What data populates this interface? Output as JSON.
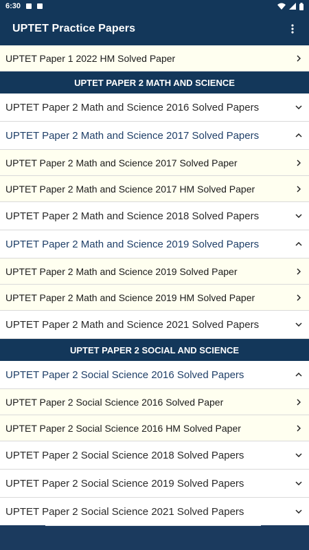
{
  "status_bar": {
    "time": "6:30"
  },
  "app_bar": {
    "title": "UPTET Practice Papers"
  },
  "colors": {
    "primary": "#13375a",
    "sub_item_bg": "#fffff0",
    "expanded_text": "#1f3f68"
  },
  "rows": [
    {
      "kind": "sub",
      "label": "UPTET Paper 1 2022 HM Solved Paper",
      "icon": "chevron-right-icon"
    },
    {
      "kind": "header",
      "label": "UPTET PAPER 2 MATH AND SCIENCE"
    },
    {
      "kind": "group",
      "label": "UPTET Paper 2 Math and Science 2016 Solved Papers",
      "icon": "chevron-down-icon",
      "expanded": false
    },
    {
      "kind": "group",
      "label": "UPTET Paper 2 Math and Science 2017 Solved Papers",
      "icon": "chevron-up-icon",
      "expanded": true
    },
    {
      "kind": "sub",
      "label": "UPTET Paper 2 Math and Science 2017 Solved Paper",
      "icon": "chevron-right-icon"
    },
    {
      "kind": "sub",
      "label": "UPTET Paper 2 Math and Science 2017 HM Solved Paper",
      "icon": "chevron-right-icon"
    },
    {
      "kind": "group",
      "label": "UPTET Paper 2 Math and Science 2018 Solved Papers",
      "icon": "chevron-down-icon",
      "expanded": false
    },
    {
      "kind": "group",
      "label": "UPTET Paper 2 Math and Science 2019 Solved Papers",
      "icon": "chevron-up-icon",
      "expanded": true
    },
    {
      "kind": "sub",
      "label": "UPTET Paper 2 Math and Science 2019 Solved Paper",
      "icon": "chevron-right-icon"
    },
    {
      "kind": "sub",
      "label": "UPTET Paper 2 Math and Science 2019 HM Solved Paper",
      "icon": "chevron-right-icon"
    },
    {
      "kind": "group",
      "label": "UPTET Paper 2 Math and Science 2021 Solved Papers",
      "icon": "chevron-down-icon",
      "expanded": false
    },
    {
      "kind": "header",
      "label": "UPTET PAPER 2 SOCIAL AND SCIENCE"
    },
    {
      "kind": "group",
      "label": "UPTET Paper 2 Social Science 2016 Solved Papers",
      "icon": "chevron-up-icon",
      "expanded": true
    },
    {
      "kind": "sub",
      "label": "UPTET Paper 2 Social Science 2016 Solved Paper",
      "icon": "chevron-right-icon"
    },
    {
      "kind": "sub",
      "label": "UPTET Paper 2 Social Science 2016 HM Solved Paper",
      "icon": "chevron-right-icon"
    },
    {
      "kind": "group",
      "label": "UPTET Paper 2 Social Science 2018 Solved Papers",
      "icon": "chevron-down-icon",
      "expanded": false
    },
    {
      "kind": "group",
      "label": "UPTET Paper 2 Social Science 2019 Solved Papers",
      "icon": "chevron-down-icon",
      "expanded": false
    },
    {
      "kind": "group",
      "label": "UPTET Paper 2 Social Science 2021 Solved Papers",
      "icon": "chevron-down-icon",
      "expanded": false
    }
  ]
}
